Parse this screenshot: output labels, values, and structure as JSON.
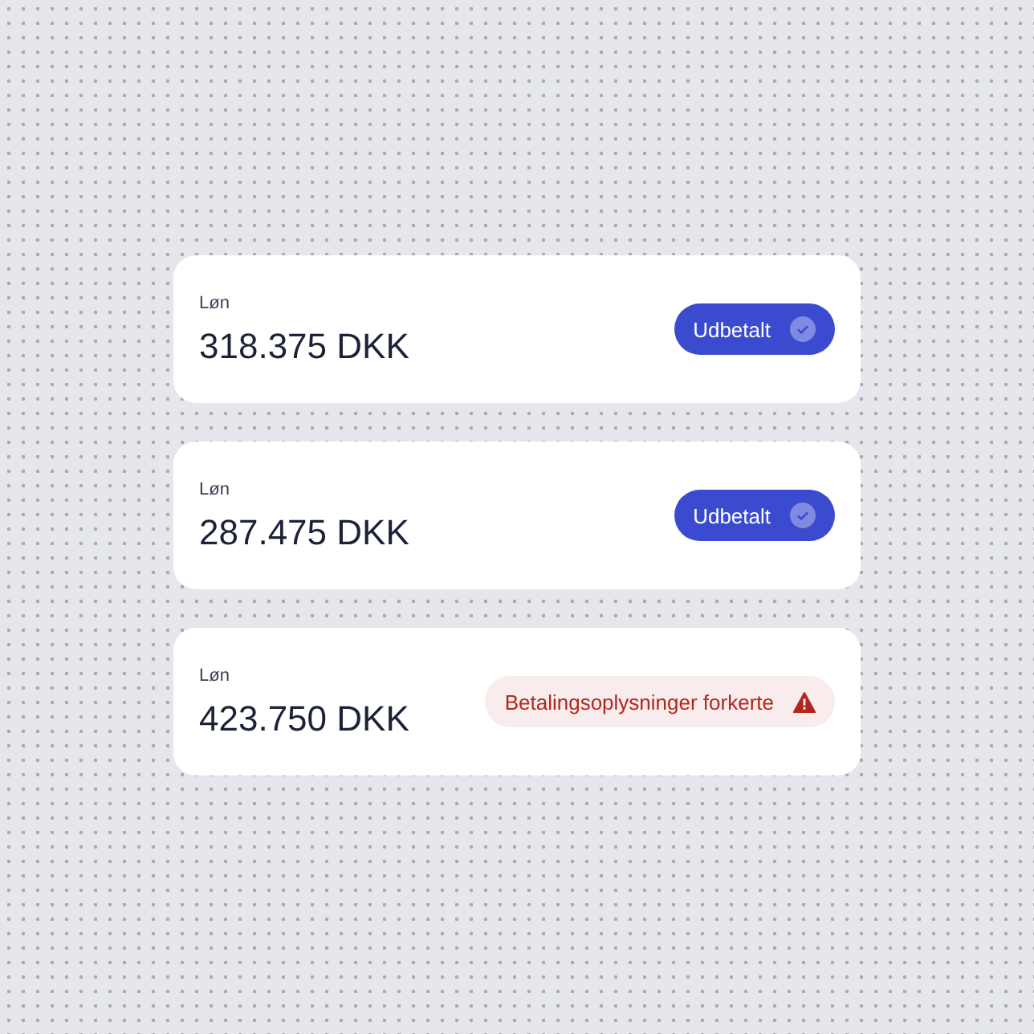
{
  "payments": [
    {
      "label": "Løn",
      "amount": "318.375 DKK",
      "status": {
        "kind": "paid",
        "text": "Udbetalt"
      }
    },
    {
      "label": "Løn",
      "amount": "287.475 DKK",
      "status": {
        "kind": "paid",
        "text": "Udbetalt"
      }
    },
    {
      "label": "Løn",
      "amount": "423.750 DKK",
      "status": {
        "kind": "error",
        "text": "Betalingsoplysninger forkerte"
      }
    }
  ]
}
